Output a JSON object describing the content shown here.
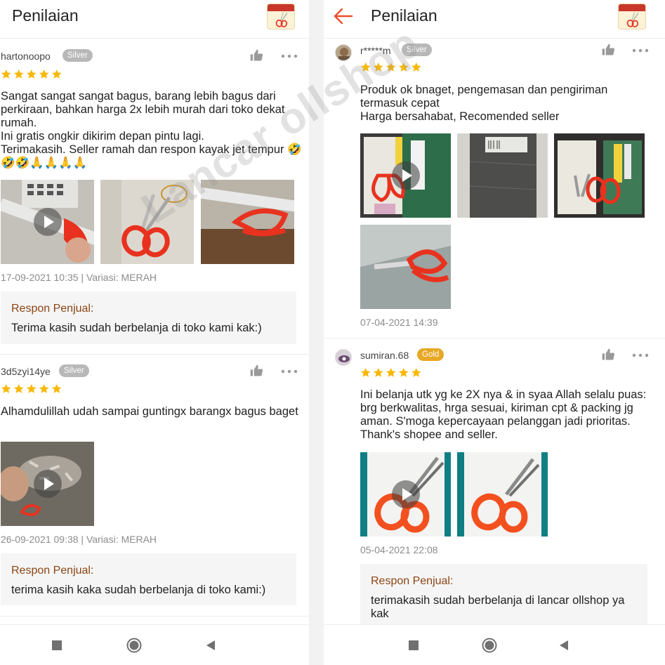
{
  "watermark": "Lancar ollshop",
  "colors": {
    "star": "#f8b808",
    "accent": "#ee4d2d",
    "response_label": "#8b4513",
    "silver": "#b8b8b8",
    "gold": "#e8a724"
  },
  "left_panel": {
    "header": {
      "title": "Penilaian"
    },
    "reviews": [
      {
        "username": "hartonoopo",
        "badge": "Silver",
        "rating": 5,
        "text": "Sangat sangat sangat bagus, barang lebih bagus dari perkiraan,  bahkan harga 2x lebih murah dari toko dekat rumah.\nIni gratis ongkir dikirim depan pintu lagi.\nTerimakasih. Seller ramah dan respon kayak jet tempur  🤣🤣🤣🙏🙏🙏🙏",
        "meta": "17-09-2021 10:35 | Variasi: MERAH",
        "response_label": "Respon Penjual:",
        "response_text": "Terima kasih sudah berbelanja di toko kami kak:)"
      },
      {
        "username": "3d5zyi14ye",
        "badge": "Silver",
        "rating": 5,
        "text": "Alhamdulillah udah sampai guntingx barangx bagus baget",
        "meta": "26-09-2021 09:38 | Variasi: MERAH",
        "response_label": "Respon Penjual:",
        "response_text": "terima kasih kaka sudah berbelanja di toko kami:)"
      }
    ]
  },
  "right_panel": {
    "header": {
      "title": "Penilaian"
    },
    "reviews": [
      {
        "username": "r*****m",
        "badge": "Silver",
        "rating": 5,
        "text": "Produk ok bnaget, pengemasan dan pengiriman termasuk cepat\nHarga bersahabat, Recomended seller",
        "meta": "07-04-2021 14:39"
      },
      {
        "username": "sumiran.68",
        "badge": "Gold",
        "rating": 5,
        "text": "Ini belanja utk yg ke 2X nya & in syaa Allah selalu puas: brg berkwalitas, hrga sesuai, kiriman cpt & packing jg aman. S'moga kepercayaan pelanggan jadi prioritas. Thank's shopee and seller.",
        "meta": "05-04-2021 22:08",
        "response_label": "Respon Penjual:",
        "response_text": "terimakasih sudah berbelanja di lancar ollshop ya kak"
      }
    ]
  },
  "navbar": {
    "icons": [
      "square-icon",
      "circle-icon",
      "triangle-back-icon"
    ]
  }
}
